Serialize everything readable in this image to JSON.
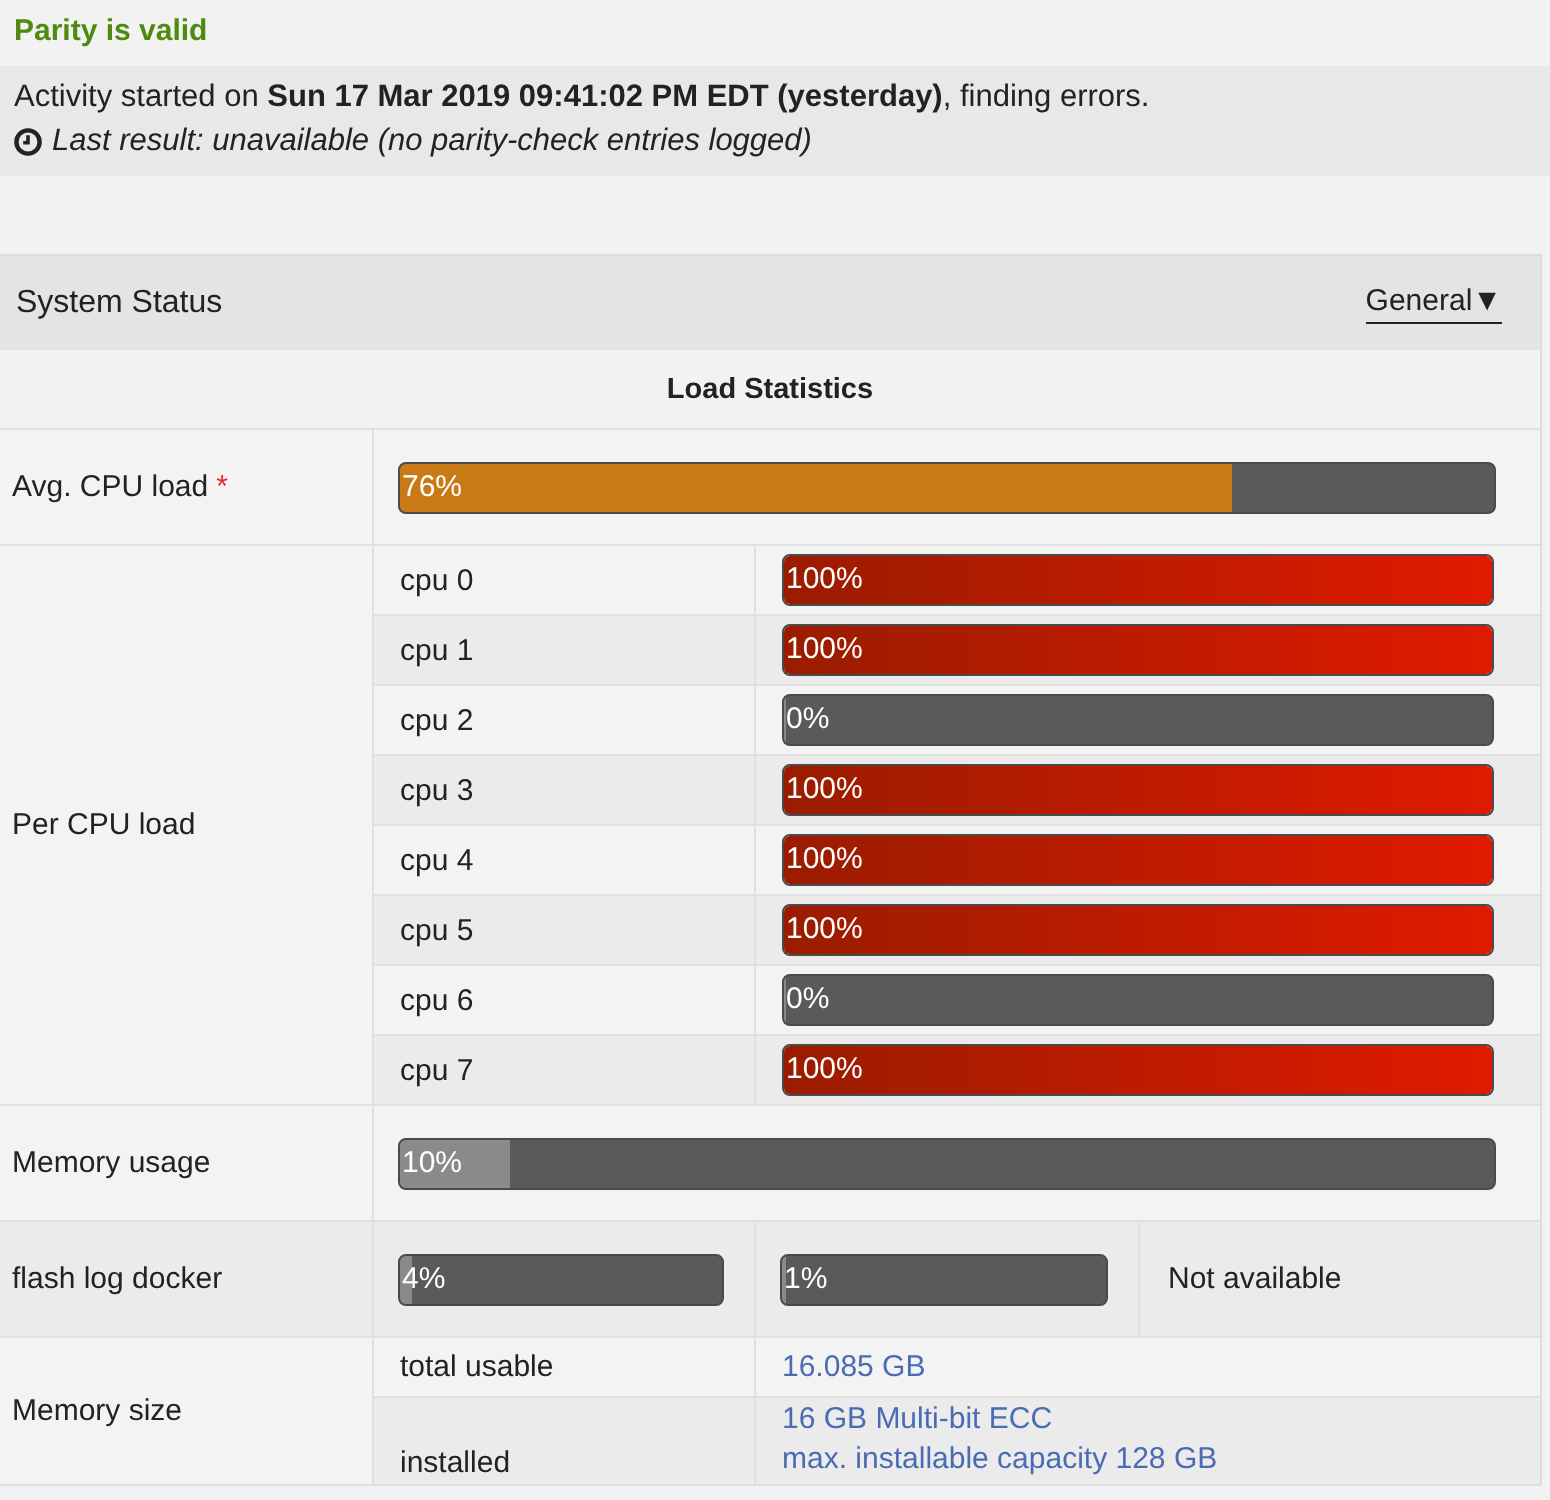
{
  "status": {
    "title": "Parity is valid"
  },
  "activity": {
    "message": "Activity started on **Sun 17 Mar 2019 09:41:02 PM EDT (yesterday)**, finding errors.",
    "last_result": "Last result: unavailable (no parity-check entries logged)"
  },
  "panel": {
    "title": "System Status",
    "view_menu": {
      "label": "General",
      "caret": "▼"
    },
    "section_heading": "Load Statistics"
  },
  "avg_cpu": {
    "label": "Avg. CPU load",
    "required_mark": "*",
    "level": 0.76,
    "reading": "76%"
  },
  "per_cpu": {
    "label": "Per CPU load",
    "cpus": [
      {
        "name": "cpu 0",
        "level": 1,
        "reading": "100%"
      },
      {
        "name": "cpu 1",
        "level": 1,
        "reading": "100%"
      },
      {
        "name": "cpu 2",
        "level": 0,
        "reading": "0%"
      },
      {
        "name": "cpu 3",
        "level": 1,
        "reading": "100%"
      },
      {
        "name": "cpu 4",
        "level": 1,
        "reading": "100%"
      },
      {
        "name": "cpu 5",
        "level": 1,
        "reading": "100%"
      },
      {
        "name": "cpu 6",
        "level": 0,
        "reading": "0%"
      },
      {
        "name": "cpu 7",
        "level": 1,
        "reading": "100%"
      }
    ]
  },
  "memory_usage": {
    "label": "Memory usage",
    "level": 0.1,
    "reading": "10%"
  },
  "filesystems": {
    "label": "flash log docker",
    "items": [
      {
        "kind": "bar",
        "level": 0.04,
        "reading": "4%"
      },
      {
        "kind": "bar",
        "level": 0.01,
        "reading": "1%"
      },
      {
        "kind": "text",
        "text": "Not available"
      }
    ]
  },
  "memory_size": {
    "label": "Memory size",
    "rows": [
      {
        "label": "total usable",
        "values": [
          "16.085 GB"
        ]
      },
      {
        "label": "installed",
        "values": [
          "16 GB Multi-bit ECC",
          "max. installable capacity 128 GB"
        ]
      }
    ]
  }
}
